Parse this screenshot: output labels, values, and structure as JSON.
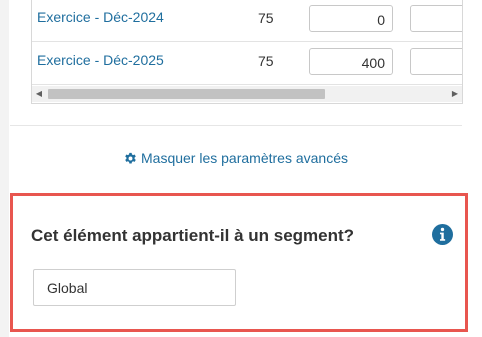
{
  "table": {
    "rows": [
      {
        "label": "Exercice - Déc-2024",
        "percent": "75",
        "value": "0"
      },
      {
        "label": "Exercice - Déc-2025",
        "percent": "75",
        "value": "400"
      }
    ]
  },
  "advanced": {
    "toggle_label": "Masquer les paramètres avancés",
    "icon": "gear-icon"
  },
  "segment": {
    "question": "Cet élément appartient-il à un segment?",
    "value": "Global",
    "info_icon": "info-icon"
  },
  "colors": {
    "link": "#1f6e9e",
    "highlight_border": "#e8564f"
  }
}
